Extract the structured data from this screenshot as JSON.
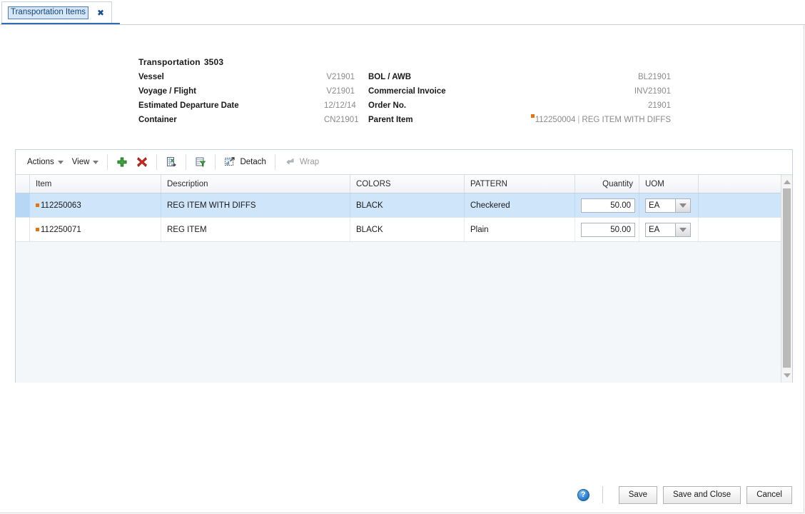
{
  "tab": {
    "label": "Transportation Items",
    "close": "✖"
  },
  "header": {
    "title": "Transportation",
    "number": "3503",
    "rows": [
      {
        "left_label": "Vessel",
        "left_value": "V21901",
        "right_label": "BOL / AWB",
        "right_value": "BL21901"
      },
      {
        "left_label": "Voyage / Flight",
        "left_value": "V21901",
        "right_label": "Commercial Invoice",
        "right_value": "INV21901"
      },
      {
        "left_label": "Estimated Departure Date",
        "left_value": "12/12/14",
        "right_label": "Order No.",
        "right_value": "21901"
      }
    ],
    "container_label": "Container",
    "container_value": "CN21901",
    "parent_item_label": "Parent Item",
    "parent_item_id": "112250004",
    "parent_item_separator": "|",
    "parent_item_desc": "REG ITEM WITH DIFFS"
  },
  "toolbar": {
    "actions_label": "Actions",
    "view_label": "View",
    "add_icon": "plus-icon",
    "delete_icon": "multiply-icon",
    "export_icon": "export-to-excel-icon",
    "query_icon": "query-by-example-icon",
    "detach_label": "Detach",
    "detach_icon": "detach-icon",
    "wrap_label": "Wrap",
    "wrap_icon": "wrap-icon"
  },
  "table": {
    "columns": [
      {
        "key": "item",
        "label": "Item",
        "align": "left"
      },
      {
        "key": "description",
        "label": "Description",
        "align": "left"
      },
      {
        "key": "colors",
        "label": "COLORS",
        "align": "left"
      },
      {
        "key": "pattern",
        "label": "PATTERN",
        "align": "left"
      },
      {
        "key": "quantity",
        "label": "Quantity",
        "align": "right"
      },
      {
        "key": "uom",
        "label": "UOM",
        "align": "left"
      }
    ],
    "rows": [
      {
        "item": "112250063",
        "description": "REG ITEM WITH DIFFS",
        "colors": "BLACK",
        "pattern": "Checkered",
        "quantity": "50.00",
        "uom": "EA",
        "selected": true
      },
      {
        "item": "112250071",
        "description": "REG ITEM",
        "colors": "BLACK",
        "pattern": "Plain",
        "quantity": "50.00",
        "uom": "EA",
        "selected": false
      }
    ]
  },
  "footer": {
    "help_label": "?",
    "save_label": "Save",
    "save_and_close_label": "Save and Close",
    "cancel_label": "Cancel"
  },
  "colors": {
    "required_marker": "#e8730a",
    "selected_row": "#cfe5fa",
    "tab_accent": "#2f6cb5",
    "value_text": "#8a8a8a"
  }
}
